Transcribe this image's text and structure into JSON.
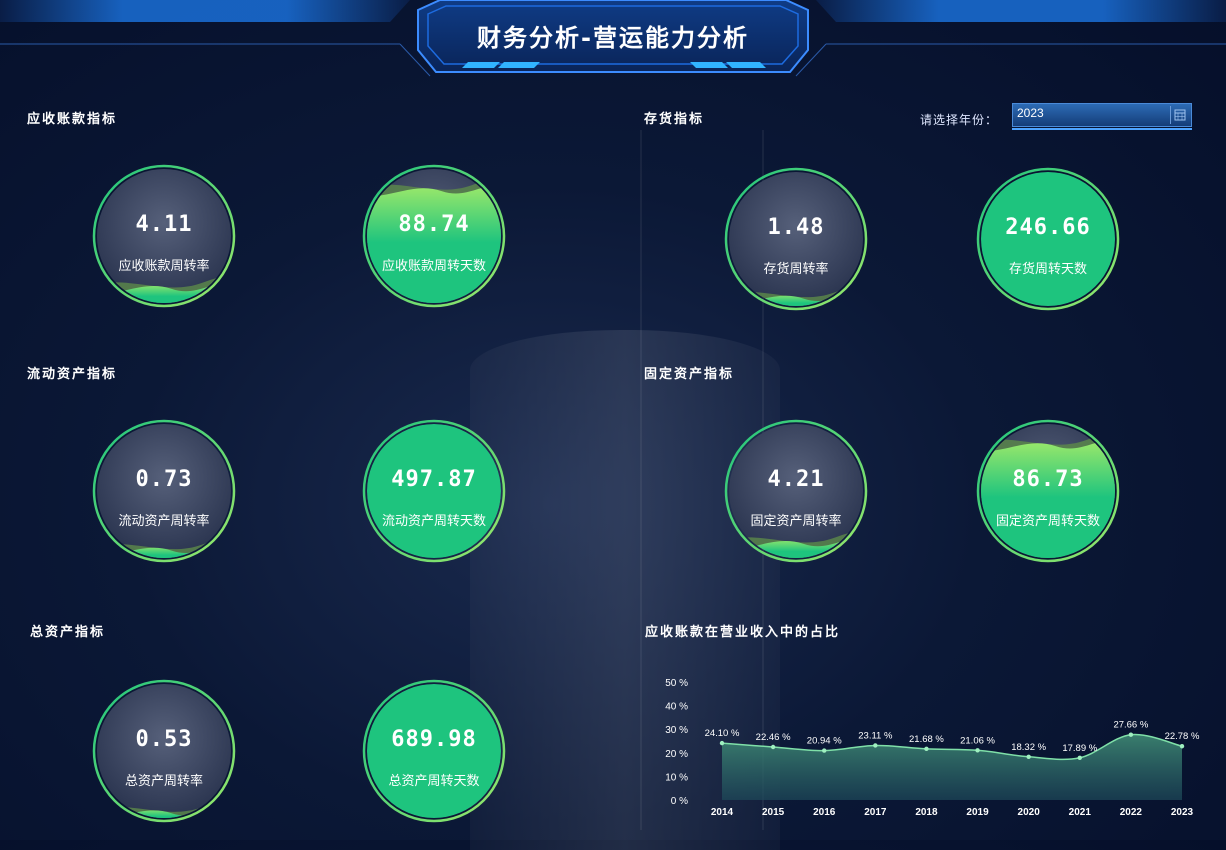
{
  "header": {
    "title": "财务分析-营运能力分析"
  },
  "sections": {
    "receivables": "应收账款指标",
    "inventory": "存货指标",
    "current_assets": "流动资产指标",
    "fixed_assets": "固定资产指标",
    "total_assets": "总资产指标",
    "chart": "应收账款在营业收入中的占比"
  },
  "year_select": {
    "label": "请选择年份：",
    "value": "2023"
  },
  "gauges": [
    {
      "value": "4.11",
      "label": "应收账款周转率",
      "fill": 0.15
    },
    {
      "value": "88.74",
      "label": "应收账款周转天数",
      "fill": 0.88
    },
    {
      "value": "1.48",
      "label": "存货周转率",
      "fill": 0.1
    },
    {
      "value": "246.66",
      "label": "存货周转天数",
      "fill": 1.0
    },
    {
      "value": "0.73",
      "label": "流动资产周转率",
      "fill": 0.1
    },
    {
      "value": "497.87",
      "label": "流动资产周转天数",
      "fill": 1.0
    },
    {
      "value": "4.21",
      "label": "固定资产周转率",
      "fill": 0.15
    },
    {
      "value": "86.73",
      "label": "固定资产周转天数",
      "fill": 0.88
    },
    {
      "value": "0.53",
      "label": "总资产周转率",
      "fill": 0.08
    },
    {
      "value": "689.98",
      "label": "总资产周转天数",
      "fill": 1.0
    }
  ],
  "colors": {
    "accent": "#1ec47e",
    "accent_light": "#9be86a",
    "empty": "#3a4560"
  },
  "chart_data": {
    "type": "area",
    "title": "应收账款在营业收入中的占比",
    "categories": [
      "2014",
      "2015",
      "2016",
      "2017",
      "2018",
      "2019",
      "2020",
      "2021",
      "2022",
      "2023"
    ],
    "values": [
      24.1,
      22.46,
      20.94,
      23.11,
      21.68,
      21.06,
      18.32,
      17.89,
      27.66,
      22.78
    ],
    "data_labels": [
      "24.10 %",
      "22.46 %",
      "20.94 %",
      "23.11 %",
      "21.68 %",
      "21.06 %",
      "18.32 %",
      "17.89 %",
      "27.66 %",
      "22.78 %"
    ],
    "ylim": [
      0,
      50
    ],
    "y_ticks": [
      "0 %",
      "10 %",
      "20 %",
      "30 %",
      "40 %",
      "50 %"
    ],
    "y_tick_values": [
      0,
      10,
      20,
      30,
      40,
      50
    ],
    "grid": false,
    "legend": "none"
  }
}
